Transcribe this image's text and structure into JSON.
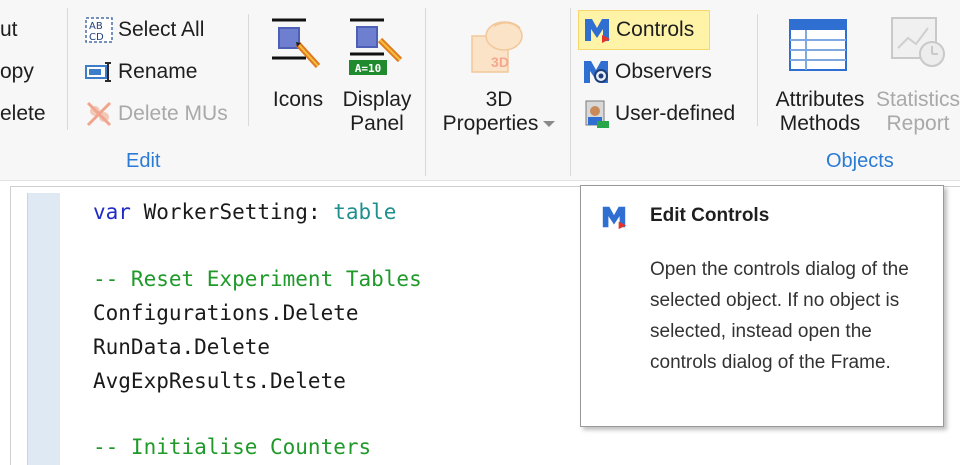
{
  "ribbon": {
    "clipboard": {
      "cut_label": "ut",
      "copy_label": "opy",
      "delete_label": "elete"
    },
    "edit_group": {
      "select_all_label": "Select All",
      "rename_label": "Rename",
      "delete_mus_label": "Delete MUs",
      "icons_label": "Icons",
      "display_panel_line1": "Display",
      "display_panel_line2": "Panel",
      "display_panel_icon_text": "A=10",
      "group_label": "Edit"
    },
    "properties_group": {
      "three_d_line1": "3D",
      "three_d_line2": "Properties",
      "three_d_icon_text": "3D"
    },
    "objects_group": {
      "controls_label": "Controls",
      "observers_label": "Observers",
      "user_defined_label": "User-defined",
      "attributes_line1": "Attributes",
      "attributes_line2": "Methods",
      "statistics_line1": "Statistics",
      "statistics_line2": "Report",
      "group_label": "Objects"
    }
  },
  "editor": {
    "line1_kw": "var",
    "line1_name": " WorkerSetting: ",
    "line1_type": "table",
    "comment1": "-- Reset Experiment Tables",
    "code1": "Configurations.Delete",
    "code2": "RunData.Delete",
    "code3": "AvgExpResults.Delete",
    "comment2": "-- Initialise Counters"
  },
  "tooltip": {
    "title": "Edit Controls",
    "body": "Open the controls dialog of the selected object. If no object is selected, instead open the controls dialog of the Frame."
  },
  "colors": {
    "accent_blue": "#2b7bd4",
    "highlight": "#fff3a8",
    "comment_green": "#1f9a2a",
    "keyword_blue": "#1f2bc7"
  }
}
